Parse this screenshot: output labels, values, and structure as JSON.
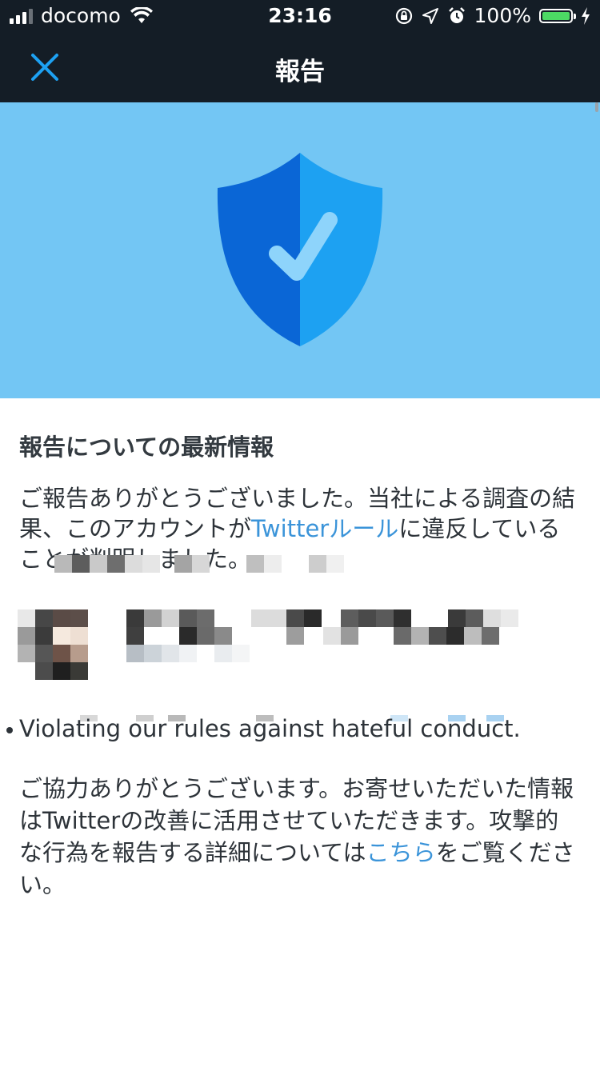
{
  "status_bar": {
    "carrier": "docomo",
    "time": "23:16",
    "battery": "100%"
  },
  "nav": {
    "title": "報告"
  },
  "content": {
    "heading": "報告についての最新情報",
    "para1_prefix": "ご報告ありがとうございました。当社による調査の結果、このアカウントが",
    "rules_link": "Twitterルール",
    "para1_suffix": "に違反していることが判明しました。",
    "violation_text": "Violating our rules against hateful conduct.",
    "para2_prefix": "ご協力ありがとうございます。お寄せいただいた情報はTwitterの改善に活用させていただきます。攻撃的な行為を報告する詳細については",
    "details_link": "こちら",
    "para2_suffix": "をご覧ください。"
  },
  "colors": {
    "nav_background": "#141d26",
    "hero_background": "#73c6f4",
    "link": "#3b94d9",
    "shield_dark": "#0a66d6",
    "shield_light": "#1da1f2"
  },
  "icons": {
    "close": "close-icon",
    "shield": "shield-check-icon"
  }
}
